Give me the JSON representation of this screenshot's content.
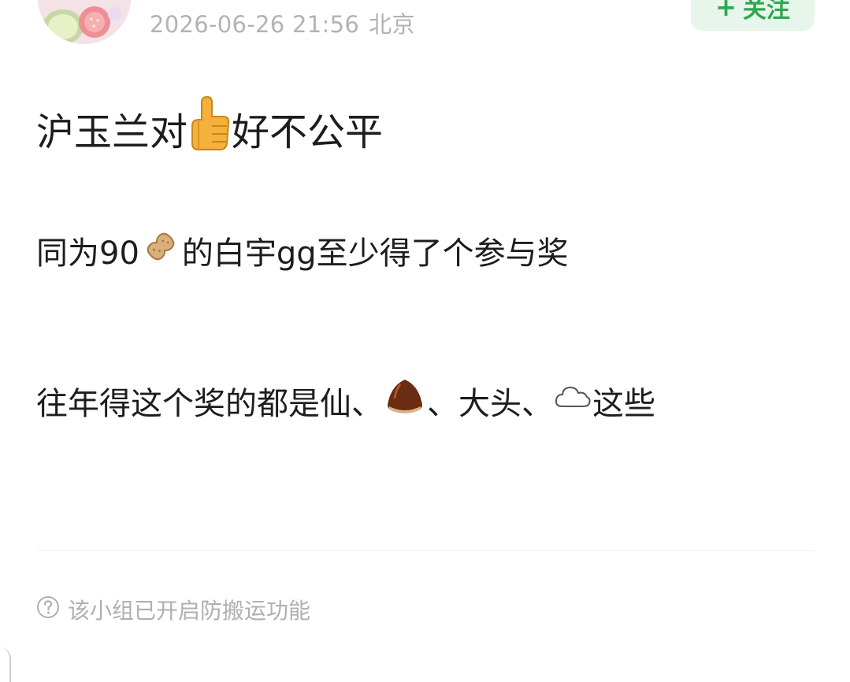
{
  "header": {
    "datetime": "2026-06-26 21:56",
    "location": "北京",
    "follow_button": {
      "plus": "+",
      "label": "关注"
    }
  },
  "post": {
    "title": {
      "before": "沪玉兰对",
      "emoji": "thumbs-up-icon",
      "after": "好不公平"
    },
    "paragraph1": {
      "before": "同为90",
      "emoji": "peanut-icon",
      "after": "的白宇gg至少得了个参与奖"
    },
    "paragraph2": {
      "part1": "往年得这个奖的都是仙、",
      "emoji1": "chestnut-icon",
      "part2": "、大头、",
      "emoji2": "cloud-icon",
      "part3": "这些"
    }
  },
  "footer": {
    "notice": "该小组已开启防搬运功能",
    "notice_icon": "help-circle-icon"
  },
  "colors": {
    "follow_bg": "#e7f5ea",
    "follow_text": "#2ea84f",
    "meta_text": "#b3b3b3",
    "body_text": "#1d1d1d"
  }
}
